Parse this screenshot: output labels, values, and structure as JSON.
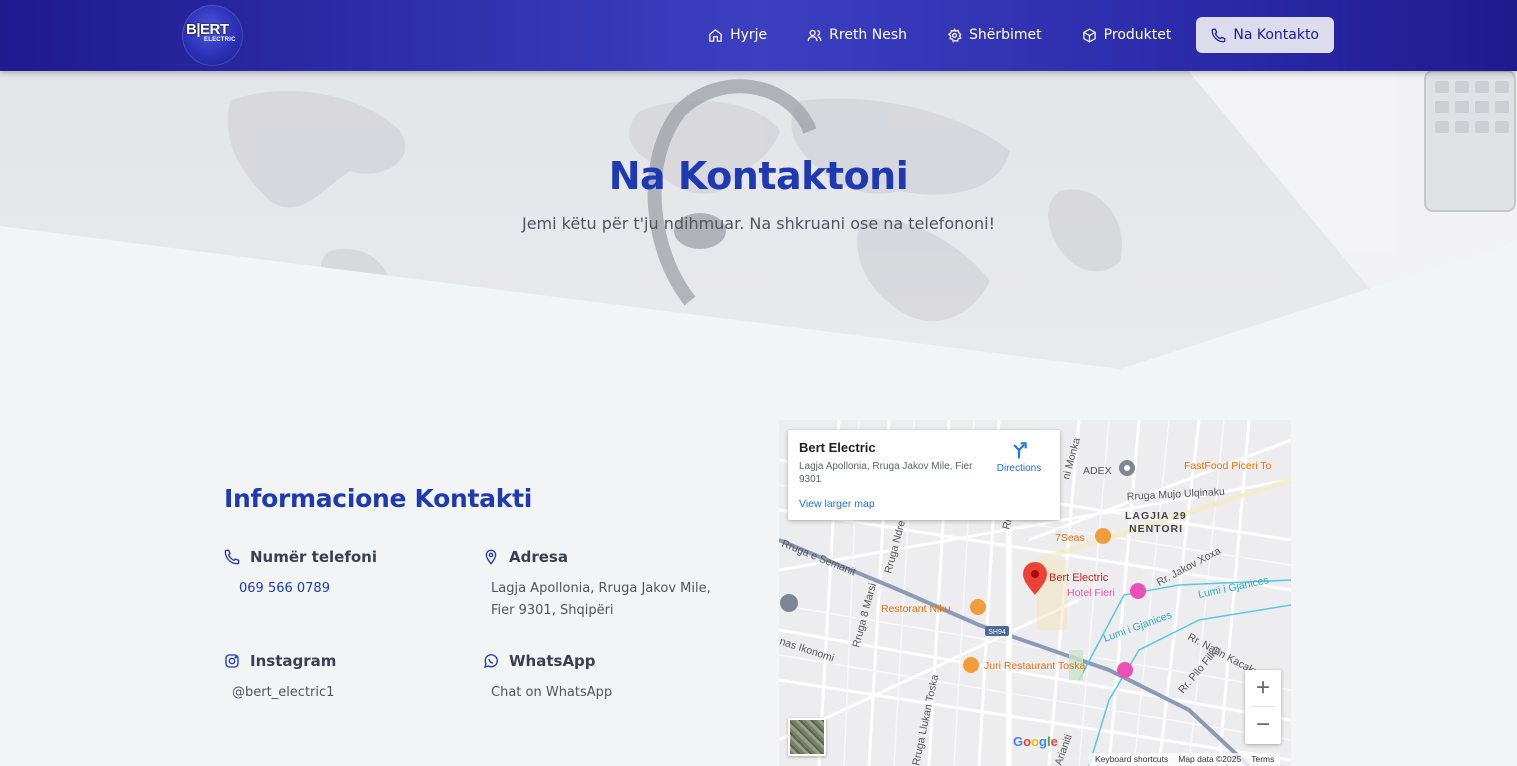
{
  "nav": {
    "logo_text": "BERT ELECTRIC",
    "items": [
      {
        "label": "Hyrje",
        "icon": "home-icon"
      },
      {
        "label": "Rreth Nesh",
        "icon": "users-icon"
      },
      {
        "label": "Shërbimet",
        "icon": "gear-icon"
      },
      {
        "label": "Produktet",
        "icon": "box-icon"
      },
      {
        "label": "Na Kontakto",
        "icon": "phone-icon",
        "active": true
      }
    ]
  },
  "hero": {
    "title": "Na Kontaktoni",
    "subtitle": "Jemi këtu për t'ju ndihmuar. Na shkruani ose na telefononi!"
  },
  "contact": {
    "title": "Informacione Kontakti",
    "phone": {
      "label": "Numër telefoni",
      "value": "069 566 0789",
      "icon": "phone-icon"
    },
    "address": {
      "label": "Adresa",
      "value": "Lagja Apollonia, Rruga Jakov Mile, Fier 9301, Shqipëri",
      "icon": "map-pin-icon"
    },
    "instagram": {
      "label": "Instagram",
      "value": "@bert_electric1",
      "icon": "instagram-icon"
    },
    "whatsapp": {
      "label": "WhatsApp",
      "value": "Chat on WhatsApp",
      "icon": "whatsapp-icon"
    }
  },
  "map": {
    "place_name": "Bert Electric",
    "place_address": "Lagja Apollonia, Rruga Jakov Mile, Fier 9301",
    "directions_label": "Directions",
    "larger_map_label": "View larger map",
    "marker_label": "Bert Electric",
    "labels": {
      "adex": "ADEX",
      "fastfood": "FastFood Piceri To",
      "mujo": "Rruga Mujo Ulqinaku",
      "lagjia1": "LAGJIA 29",
      "lagjia2": "NENTORI",
      "sevenseas": "7Seas",
      "hotel": "Hotel Fieri",
      "jakov": "Rr. Jakov Xoxa",
      "gjanices": "Lumi i Gjanices",
      "gjanices2": "Lumi i Gjanices",
      "naun": "Rr. Naun Kacaku",
      "pilo": "Rr. Pilo Filka",
      "semanit": "Rruga e Semanit",
      "marsi": "Rruga 8 Marsi",
      "ndre": "Rruga Ndre",
      "monka": "ni Monka",
      "niku": "Restorant Niku",
      "sh94": "SH94",
      "ikonomi": "nas Ikonomi",
      "juri": "Juri Restaurant Toska",
      "lluka": "Rruga Llukan Toska",
      "arianiti": "Arianiti",
      "rre": "Rr. Re"
    },
    "zoom_in": "+",
    "zoom_out": "−",
    "google": "Google",
    "footer": [
      "Keyboard shortcuts",
      "Map data ©2025",
      "Terms"
    ]
  }
}
